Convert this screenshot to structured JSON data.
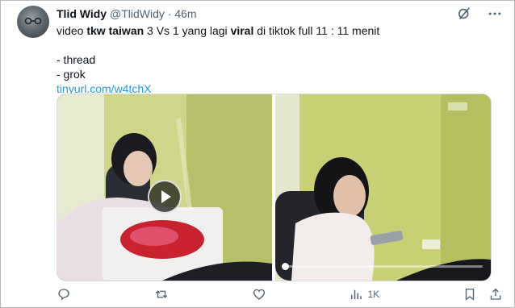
{
  "author": {
    "display_name": "Tlid Widy",
    "handle": "@TlidWidy",
    "separator": "·",
    "timestamp": "46m"
  },
  "tweet": {
    "line1_parts": [
      "video ",
      "tkw taiwan",
      " 3 Vs 1 yang lagi ",
      "viral",
      " di tiktok full 11 : 11 menit"
    ],
    "list": [
      "- thread",
      "- grok"
    ],
    "link": "tinyurl.com/w4tchX"
  },
  "media": {
    "count": 2,
    "left_video_has_play_button": true,
    "right_video_progress": 0.01
  },
  "actions": {
    "reply_icon": "reply-icon",
    "retweet_icon": "retweet-icon",
    "like_icon": "heart-icon",
    "views_icon": "views-icon",
    "views_count": "1K",
    "bookmark_icon": "bookmark-icon",
    "share_icon": "share-icon"
  },
  "top_icons": [
    "grok-icon",
    "more-icon"
  ],
  "colors": {
    "link": "#1d9bf0",
    "muted": "#536471",
    "text": "#0f1419"
  }
}
